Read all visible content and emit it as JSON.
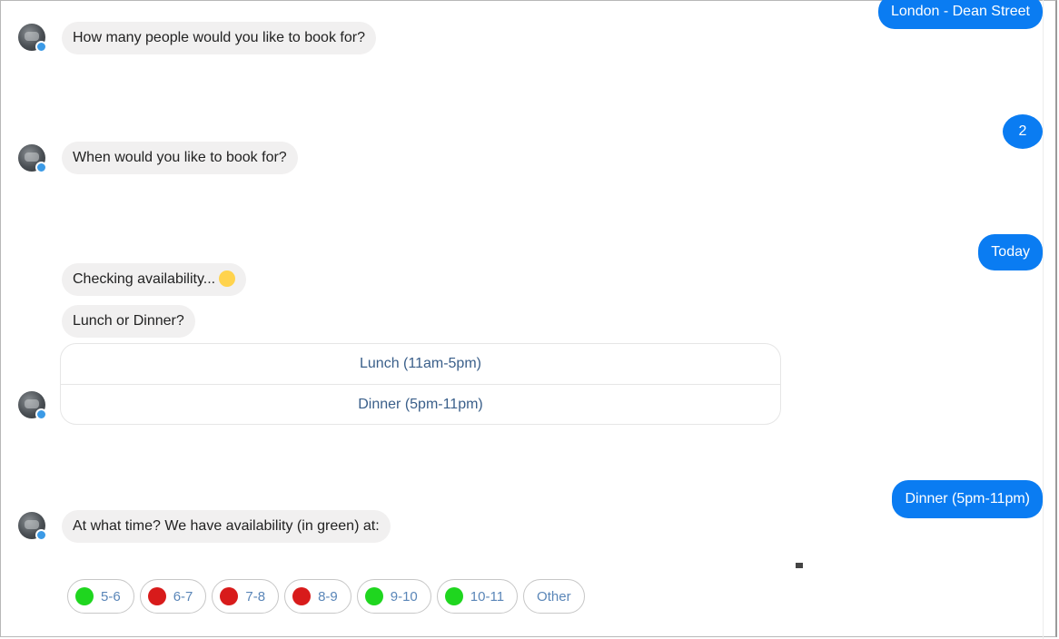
{
  "conversation": {
    "user_messages": {
      "location": "London - Dean Street",
      "party_size": "2",
      "day": "Today",
      "meal": "Dinner (5pm-11pm)"
    },
    "bot_messages": {
      "ask_party_size": "How many people would you like to book for?",
      "ask_when": "When would you like to book for?",
      "checking": "Checking availability...",
      "lunch_or_dinner": "Lunch or Dinner?",
      "ask_time": "At what time? We have availability (in green) at:"
    },
    "meal_options": [
      "Lunch (11am-5pm)",
      "Dinner (5pm-11pm)"
    ],
    "time_slots": [
      {
        "label": "5-6",
        "available": true
      },
      {
        "label": "6-7",
        "available": false
      },
      {
        "label": "7-8",
        "available": false
      },
      {
        "label": "8-9",
        "available": false
      },
      {
        "label": "9-10",
        "available": true
      },
      {
        "label": "10-11",
        "available": true
      },
      {
        "label": "Other"
      }
    ]
  },
  "colors": {
    "user_bubble": "#0a7cf2",
    "bot_bubble": "#f1f0f0",
    "available": "#1fd61f",
    "unavailable": "#d81b1b"
  }
}
